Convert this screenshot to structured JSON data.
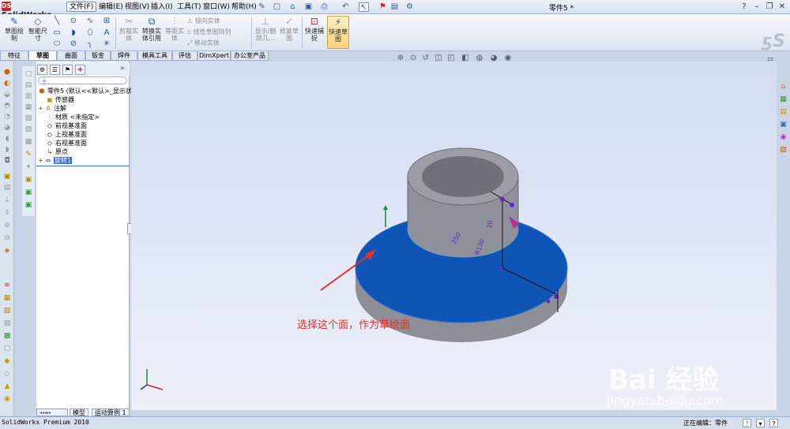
{
  "app": {
    "name": "SolidWorks",
    "document_title": "零件5 *"
  },
  "menu": {
    "items": [
      {
        "label": "文件(F)",
        "boxed": true
      },
      {
        "label": "编辑(E)"
      },
      {
        "label": "视图(V)"
      },
      {
        "label": "插入(I)"
      },
      {
        "label": "工具(T)"
      },
      {
        "label": "窗口(W)"
      },
      {
        "label": "帮助(H)"
      }
    ],
    "help_icon": "?"
  },
  "commands": {
    "sketch": "草图绘\n制",
    "smart_dim": "智能尺\n寸",
    "trim": "剪裁实\n体",
    "convert": "转换实\n体引用",
    "offset": "等距实\n体",
    "mirror": "镜向实体",
    "linear_pattern": "线性草图阵列",
    "move": "移动实体",
    "display_delete": "显示/删\n除几...",
    "repair": "修复草\n图",
    "quick_snap": "快速捕\n捉",
    "rapid_sketch": "快速草\n图"
  },
  "tabs": [
    {
      "label": "特征"
    },
    {
      "label": "草图",
      "active": true
    },
    {
      "label": "曲面"
    },
    {
      "label": "钣金"
    },
    {
      "label": "焊件"
    },
    {
      "label": "模具工具"
    },
    {
      "label": "评估"
    },
    {
      "label": "DimXpert"
    },
    {
      "label": "办公室产品"
    }
  ],
  "feature_tree": {
    "root": "零件5  (默认<<默认>_显示状态",
    "items": [
      {
        "label": "传感器",
        "icon": "sensor-icon"
      },
      {
        "label": "注解",
        "icon": "annotation-icon",
        "expand": "+"
      },
      {
        "label": "材质 <未指定>",
        "icon": "material-icon"
      },
      {
        "label": "前视基准面",
        "icon": "plane-icon"
      },
      {
        "label": "上视基准面",
        "icon": "plane-icon"
      },
      {
        "label": "右视基准面",
        "icon": "plane-icon"
      },
      {
        "label": "原点",
        "icon": "origin-icon"
      },
      {
        "label": "旋转1",
        "icon": "revolve-icon",
        "expand": "+",
        "selected": true
      }
    ]
  },
  "bottom_tabs": [
    {
      "label": "模型",
      "active": true
    },
    {
      "label": "运动算例 1"
    }
  ],
  "annotation": "选择这个面，作为草绘面",
  "watermark": {
    "brand": "Bai 经验",
    "url": "jingyan.baidu.com"
  },
  "status": {
    "product": "SolidWorks Premium 2010",
    "editing": "正在编辑：零件"
  },
  "dims": {
    "d1": "20",
    "d2": "R130",
    "d3": "250"
  },
  "colors": {
    "face_blue": "#0e55b5",
    "cylinder_gray": "#8c8e97",
    "annotation_red": "#e0322a"
  }
}
